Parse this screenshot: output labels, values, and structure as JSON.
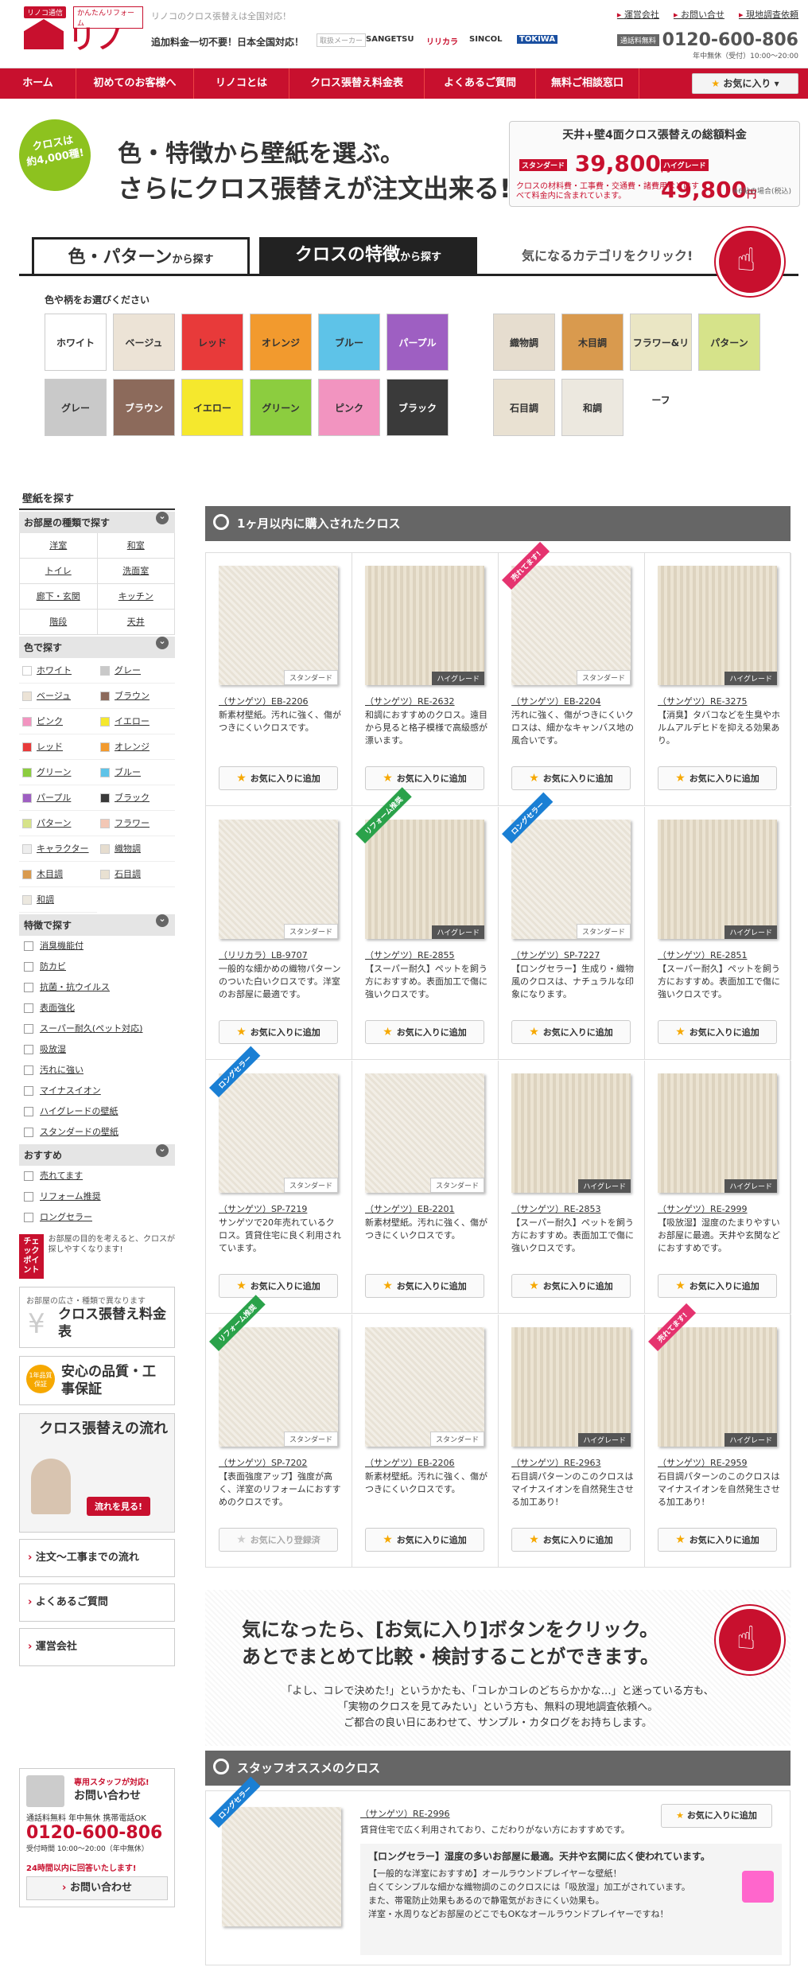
{
  "header": {
    "logo_tag1": "リノコ通信",
    "logo_tag2": "かんたんリフォーム",
    "logo": "リノコ",
    "tagline": "リノコのクロス張替えは全国対応！",
    "free_note": "追加料金一切不要！日本全国対応！",
    "makers_label": "取扱メーカー",
    "makers": [
      "SANGETSU",
      "リリカラ",
      "SINCOL",
      "TOKIWA"
    ],
    "top_links": [
      "運営会社",
      "お問い合せ",
      "現地調査依頼"
    ],
    "tel_badge": "通話料無料",
    "tel": "0120-600-806",
    "tel_hours": "年中無休（受付）10:00〜20:00"
  },
  "nav": {
    "items": [
      "ホーム",
      "初めてのお客様へ",
      "リノコとは",
      "クロス張替え料金表",
      "よくあるご質問",
      "無料ご相談窓口"
    ],
    "fav_button": "お気に入り"
  },
  "hero": {
    "circle": [
      "クロスは",
      "約4,000種!"
    ],
    "line1": "色・特徴から壁紙を選ぶ。",
    "line2": "さらにクロス張替えが注文出来る!",
    "price_title": "天井+壁4面クロス張替えの総額料金",
    "std_label": "スタンダード",
    "std_price": "39,800",
    "high_label": "ハイグレード",
    "high_price": "49,800",
    "yen": "円",
    "note": "クロスの材料費・工事費・交通費・諸費用などはすべて料金内に含まれています。",
    "note2": "※6帖の場合(税込)"
  },
  "tabs": {
    "tab1_main": "色・パターン",
    "tab1_small": "から探す",
    "tab2_main": "クロスの特徴",
    "tab2_small": "から探す",
    "hint": "気になるカテゴリをクリック!"
  },
  "colors": {
    "label": "色や柄をお選びください",
    "items": [
      {
        "label": "ホワイト",
        "bg": "#ffffff",
        "dark": false
      },
      {
        "label": "ベージュ",
        "bg": "#ece3d6",
        "dark": false
      },
      {
        "label": "レッド",
        "bg": "#e83a3a",
        "dark": false
      },
      {
        "label": "オレンジ",
        "bg": "#f29a2e",
        "dark": false
      },
      {
        "label": "ブルー",
        "bg": "#5ec3e8",
        "dark": false
      },
      {
        "label": "パープル",
        "bg": "#9e5fc2",
        "dark": true
      },
      {
        "label": "グレー",
        "bg": "#c9c9c9",
        "dark": false
      },
      {
        "label": "ブラウン",
        "bg": "#8c6a5b",
        "dark": true
      },
      {
        "label": "イエロー",
        "bg": "#f5e82d",
        "dark": false
      },
      {
        "label": "グリーン",
        "bg": "#8ccd3f",
        "dark": false
      },
      {
        "label": "ピンク",
        "bg": "#f294c0",
        "dark": false
      },
      {
        "label": "ブラック",
        "bg": "#3a3a3a",
        "dark": true
      }
    ],
    "patterns": [
      {
        "label": "織物調",
        "bg": "#e6ddcf"
      },
      {
        "label": "木目調",
        "bg": "#d99a4e"
      },
      {
        "label": "フラワー&リーフ",
        "bg": "#eae6c4"
      },
      {
        "label": "パターン",
        "bg": "#d6e38a"
      },
      {
        "label": "石目調",
        "bg": "#e9e1d2"
      },
      {
        "label": "和調",
        "bg": "#ece8df"
      }
    ]
  },
  "sidebar": {
    "title": "壁紙を探す",
    "room_cat": "お部屋の種類で探す",
    "rooms": [
      "洋室",
      "和室",
      "トイレ",
      "洗面室",
      "廊下・玄関",
      "キッチン",
      "階段",
      "天井"
    ],
    "color_cat": "色で探す",
    "colors": [
      {
        "label": "ホワイト",
        "c": "#ffffff"
      },
      {
        "label": "グレー",
        "c": "#c9c9c9"
      },
      {
        "label": "ベージュ",
        "c": "#ece3d6"
      },
      {
        "label": "ブラウン",
        "c": "#8c6a5b"
      },
      {
        "label": "ピンク",
        "c": "#f294c0"
      },
      {
        "label": "イエロー",
        "c": "#f5e82d"
      },
      {
        "label": "レッド",
        "c": "#e83a3a"
      },
      {
        "label": "オレンジ",
        "c": "#f29a2e"
      },
      {
        "label": "グリーン",
        "c": "#8ccd3f"
      },
      {
        "label": "ブルー",
        "c": "#5ec3e8"
      },
      {
        "label": "パープル",
        "c": "#9e5fc2"
      },
      {
        "label": "ブラック",
        "c": "#3a3a3a"
      },
      {
        "label": "パターン",
        "c": "#d6e38a"
      },
      {
        "label": "フラワー",
        "c": "#f3c7b5"
      },
      {
        "label": "キャラクター",
        "c": "#eee"
      },
      {
        "label": "織物調",
        "c": "#e6ddcf"
      },
      {
        "label": "木目調",
        "c": "#d99a4e"
      },
      {
        "label": "石目調",
        "c": "#e9e1d2"
      },
      {
        "label": "和調",
        "c": "#ece8df"
      }
    ],
    "feature_cat": "特徴で探す",
    "features": [
      "消臭機能付",
      "防カビ",
      "抗菌・抗ウイルス",
      "表面強化",
      "スーパー耐久(ペット対応)",
      "吸放湿",
      "汚れに強い",
      "マイナスイオン",
      "ハイグレードの壁紙",
      "スタンダードの壁紙"
    ],
    "recommend_cat": "おすすめ",
    "recommends": [
      "売れてます",
      "リフォーム推奨",
      "ロングセラー"
    ],
    "check_badge": "チェックポイント",
    "check_text": "お部屋の目的を考えると、クロスが探しやすくなります!",
    "banner1_small": "お部屋の広さ・種類で異なります",
    "banner1_big": "クロス張替え料金表",
    "banner2_badge": "1年品質保証",
    "banner2_big": "安心の品質・工事保証",
    "banner3_big": "クロス張替えの流れ",
    "banner3_btn": "流れを見る!",
    "links": [
      "注文〜工事までの流れ",
      "よくあるご質問",
      "運営会社"
    ],
    "contact_t1": "専用スタッフが対応!",
    "contact_t2": "お問い合わせ",
    "contact_lbl": "通話料無料 年中無休 携帯電話OK",
    "contact_tel": "0120-600-806",
    "contact_hrs": "受付時間 10:00〜20:00（年中無休）",
    "contact_reply": "24時間以内に回答いたします!",
    "contact_btn": "お問い合わせ"
  },
  "recent": {
    "title": "1ヶ月以内に購入されたクロス",
    "fav_label": "お気に入りに追加",
    "fav_done": "お気に入り登録済",
    "products": [
      {
        "name": "（サンゲツ）EB-2206",
        "desc": "新素材壁紙。汚れに強く、傷がつきにくいクロスです。",
        "grade": "スタンダード",
        "ribbon": "",
        "rc": "",
        "done": false
      },
      {
        "name": "（サンゲツ）RE-2632",
        "desc": "和調におすすめのクロス。遠目から見ると格子模様で高級感が漂います。",
        "grade": "ハイグレード",
        "ribbon": "",
        "rc": "",
        "done": false
      },
      {
        "name": "（サンゲツ）EB-2204",
        "desc": "汚れに強く、傷がつきにくいクロスは、細かなキャンバス地の風合いです。",
        "grade": "スタンダード",
        "ribbon": "売れてます!",
        "rc": "#e5336f",
        "done": false
      },
      {
        "name": "（サンゲツ）RE-3275",
        "desc": "【消臭】タバコなどを生臭やホルムアルデヒドを抑える効果あり。",
        "grade": "ハイグレード",
        "ribbon": "",
        "rc": "",
        "done": false
      },
      {
        "name": "（リリカラ）LB-9707",
        "desc": "一般的な細かめの織物パターンのついた白いクロスです。洋室のお部屋に最適です。",
        "grade": "スタンダード",
        "ribbon": "",
        "rc": "",
        "done": false
      },
      {
        "name": "（サンゲツ）RE-2855",
        "desc": "【スーパー耐久】ペットを飼う方におすすめ。表面加工で傷に強いクロスです。",
        "grade": "ハイグレード",
        "ribbon": "リフォーム推奨",
        "rc": "#2aa24a",
        "done": false
      },
      {
        "name": "（サンゲツ）SP-7227",
        "desc": "【ロングセラー】生成り・織物風のクロスは、ナチュラルな印象になります。",
        "grade": "スタンダード",
        "ribbon": "ロングセラー",
        "rc": "#1a7fd4",
        "done": false
      },
      {
        "name": "（サンゲツ）RE-2851",
        "desc": "【スーパー耐久】ペットを飼う方におすすめ。表面加工で傷に強いクロスです。",
        "grade": "ハイグレード",
        "ribbon": "",
        "rc": "",
        "done": false
      },
      {
        "name": "（サンゲツ）SP-7219",
        "desc": "サンゲツで20年売れているクロス。賃貸住宅に良く利用されています。",
        "grade": "スタンダード",
        "ribbon": "ロングセラー",
        "rc": "#1a7fd4",
        "done": false
      },
      {
        "name": "（サンゲツ）EB-2201",
        "desc": "新素材壁紙。汚れに強く、傷がつきにくいクロスです。",
        "grade": "スタンダード",
        "ribbon": "",
        "rc": "",
        "done": false
      },
      {
        "name": "（サンゲツ）RE-2853",
        "desc": "【スーパー耐久】ペットを飼う方におすすめ。表面加工で傷に強いクロスです。",
        "grade": "ハイグレード",
        "ribbon": "",
        "rc": "",
        "done": false
      },
      {
        "name": "（サンゲツ）RE-2999",
        "desc": "【吸放湿】湿度のたまりやすいお部屋に最適。天井や玄関などにおすすめです。",
        "grade": "ハイグレード",
        "ribbon": "",
        "rc": "",
        "done": false
      },
      {
        "name": "（サンゲツ）SP-7202",
        "desc": "【表面強度アップ】強度が高く、洋室のリフォームにおすすめのクロスです。",
        "grade": "スタンダード",
        "ribbon": "リフォーム推奨",
        "rc": "#2aa24a",
        "done": true
      },
      {
        "name": "（サンゲツ）EB-2206",
        "desc": "新素材壁紙。汚れに強く、傷がつきにくいクロスです。",
        "grade": "スタンダード",
        "ribbon": "",
        "rc": "",
        "done": false
      },
      {
        "name": "（サンゲツ）RE-2963",
        "desc": "石目調パターンのこのクロスはマイナスイオンを自然発生させる加工あり!",
        "grade": "ハイグレード",
        "ribbon": "",
        "rc": "",
        "done": false
      },
      {
        "name": "（サンゲツ）RE-2959",
        "desc": "石目調パターンのこのクロスはマイナスイオンを自然発生させる加工あり!",
        "grade": "ハイグレード",
        "ribbon": "売れてます!",
        "rc": "#e5336f",
        "done": false
      }
    ]
  },
  "promo": {
    "line1": "気になったら、[お気に入り]ボタンをクリック。",
    "line2": "あとでまとめて比較・検討することができます。",
    "p1": "「よし、コレで決めた!」というかたも、「コレかコレのどちらかかな…」と迷っている方も、",
    "p2": "「実物のクロスを見てみたい」という方も、無料の現地調査依頼へ。",
    "p3": "ご都合の良い日にあわせて、サンプル・カタログをお持ちします。"
  },
  "staff": {
    "title": "スタッフオススメのクロス",
    "ribbon": "ロングセラー",
    "name": "（サンゲツ）RE-2996",
    "desc": "賃貸住宅で広く利用されており、こだわりがない方におすすめです。",
    "fav": "お気に入りに追加",
    "box_title": "【ロングセラー】湿度の多いお部屋に最適。天井や玄関に広く使われています。",
    "box_l1": "【一般的な洋室におすすめ】オールラウンドプレイヤーな壁紙！",
    "box_l2": "白くてシンプルな細かな織物調のこのクロスには「吸放湿」加工がされています。",
    "box_l3": "また、帯電防止効果もあるので静電気がおきにくい効果も。",
    "box_l4": "洋室・水周りなどお部屋のどこでもOKなオールラウンドプレイヤーですね！"
  }
}
